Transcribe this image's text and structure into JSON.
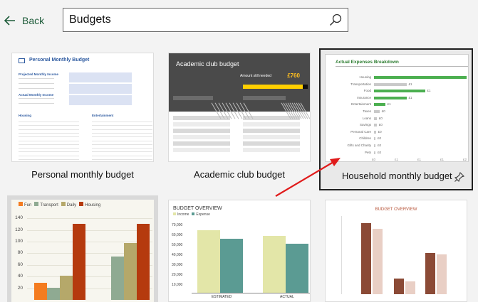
{
  "header": {
    "back_label": "Back",
    "search_value": "Budgets"
  },
  "templates": [
    {
      "name": "Personal monthly budget"
    },
    {
      "name": "Academic club budget"
    },
    {
      "name": "Household monthly budget",
      "selected": true
    }
  ],
  "personal_thumb": {
    "title": "Personal Monthly Budget",
    "proj_income": "Projected Monthly Income",
    "act_income": "Actual Monthly Income",
    "housing": "Housing",
    "entertainment": "Entertainment"
  },
  "academic_thumb": {
    "title": "Academic club budget",
    "amount_label": "Amount still needed",
    "amount_value": "£760"
  },
  "household_thumb": {
    "title": "Actual Expenses Breakdown",
    "categories": [
      "Housing",
      "Transportation",
      "Food",
      "Insurance",
      "Entertainment",
      "Taxes",
      "Loans",
      "Savings",
      "Personal Care",
      "Children",
      "Gifts and Charity",
      "Pets"
    ],
    "values": [
      1.0,
      0.35,
      0.55,
      0.35,
      0.12,
      0.06,
      0.03,
      0.03,
      0.02,
      0.01,
      0.01,
      0.01
    ],
    "value_labels": [
      "",
      "£1",
      "£1",
      "£1",
      "£1",
      "£0",
      "£0",
      "£0",
      "£0",
      "£0",
      "£0",
      "£0"
    ],
    "ticks": [
      "£0",
      "£1",
      "£1",
      "£1",
      "£2"
    ],
    "colors": {
      "green": "#4caf50",
      "light_gray": "#c9c9c9"
    }
  },
  "bottom_left_chart": {
    "legend": [
      "Fun",
      "Transport",
      "Daily",
      "Housing"
    ],
    "colors": [
      "#f47c20",
      "#8faa92",
      "#b5a86a",
      "#b53a0e"
    ],
    "ticks": [
      "140",
      "120",
      "100",
      "80",
      "60",
      "40",
      "20"
    ]
  },
  "budget_overview_chart": {
    "title": "BUDGET OVERVIEW",
    "legend": [
      "Income",
      "Expense"
    ],
    "colors": [
      "#e3e6a8",
      "#5b9b93"
    ],
    "ticks": [
      "70,000",
      "60,000",
      "50,000",
      "40,000",
      "30,000",
      "20,000",
      "10,000"
    ],
    "categories": [
      "ESTIMATED",
      "ACTUAL"
    ]
  },
  "budget_overview2": {
    "title": "BUDGET OVERVIEW",
    "colors": [
      "#8b4a36",
      "#e9cfc5"
    ]
  }
}
